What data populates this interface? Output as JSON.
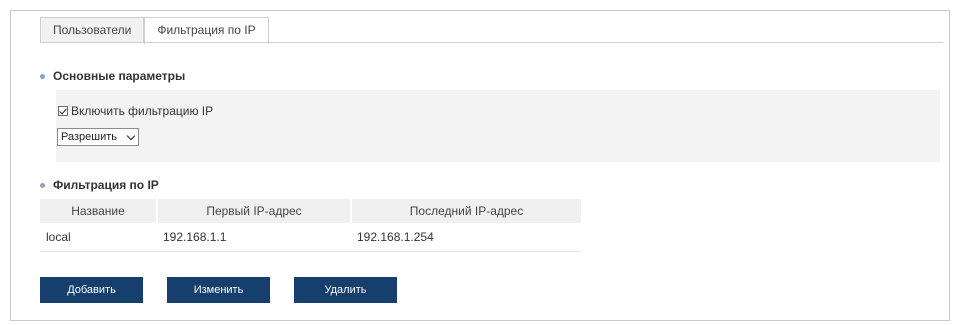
{
  "tabs": [
    {
      "label": "Пользователи",
      "active": false
    },
    {
      "label": "Фильтрация по IP",
      "active": true
    }
  ],
  "basic": {
    "title": "Основные параметры",
    "enable_label": "Включить фильтрацию IP",
    "enable_checked": true,
    "mode_value": "Разрешить"
  },
  "filter": {
    "title": "Фильтрация по IP",
    "columns": [
      "Название",
      "Первый IP-адрес",
      "Последний IP-адрес"
    ],
    "rows": [
      {
        "name": "local",
        "first_ip": "192.168.1.1",
        "last_ip": "192.168.1.254"
      }
    ]
  },
  "buttons": {
    "add": "Добавить",
    "edit": "Изменить",
    "delete": "Удалить"
  },
  "colors": {
    "button_bg": "#163f6e",
    "bullet": "#8aa3c1"
  }
}
